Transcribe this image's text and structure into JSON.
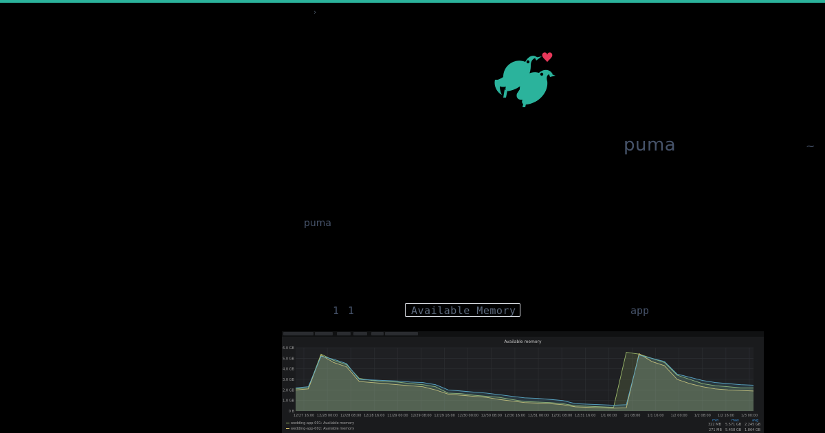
{
  "header": {
    "breadcrumb_glyph": "›"
  },
  "logo": {
    "name": "two-birds-heart-logo"
  },
  "hero": {
    "title": "puma",
    "tilde": "~"
  },
  "section": {
    "label": "puma"
  },
  "caption_row": {
    "number": "1 1",
    "highlighted": "Available Memory",
    "tag": "app"
  },
  "colors": {
    "accent": "#2bb39c",
    "heart": "#e8385a",
    "background": "#000000"
  },
  "chart_data": {
    "type": "area",
    "title": "Available memory",
    "ylabel": "",
    "xlabel": "",
    "ylim": [
      0,
      6
    ],
    "y_ticks": [
      "0 B",
      "1.0 GB",
      "2.0 GB",
      "3.0 GB",
      "4.0 GB",
      "5.0 GB",
      "6.0 GB"
    ],
    "x_ticks": [
      "12/27 16:00",
      "12/28 00:00",
      "12/28 08:00",
      "12/28 16:00",
      "12/29 00:00",
      "12/29 08:00",
      "12/29 16:00",
      "12/30 00:00",
      "12/30 08:00",
      "12/30 16:00",
      "12/31 00:00",
      "12/31 08:00",
      "12/31 16:00",
      "1/1 00:00",
      "1/1 08:00",
      "1/1 16:00",
      "1/2 00:00",
      "1/2 08:00",
      "1/2 16:00",
      "1/3 00:00"
    ],
    "grid": true,
    "legend_columns": [
      "min",
      "max",
      "avg"
    ],
    "series": [
      {
        "name": "wedding-app-001: Available memory",
        "color": "#9ab86a",
        "stats": [
          "322 MB",
          "5.571 GB",
          "2.245 GB"
        ],
        "values": [
          2.1,
          2.2,
          5.4,
          4.8,
          4.4,
          3.1,
          2.9,
          2.8,
          2.75,
          2.6,
          2.5,
          2.3,
          1.7,
          1.65,
          1.5,
          1.4,
          1.3,
          1.1,
          0.9,
          0.85,
          0.8,
          0.7,
          0.5,
          0.45,
          0.4,
          0.35,
          5.57,
          5.4,
          5.0,
          4.6,
          3.4,
          3.0,
          2.6,
          2.4,
          2.3,
          2.2,
          2.2
        ]
      },
      {
        "name": "wedding-app-002: Available memory",
        "color": "#d6c16a",
        "stats": [
          "271 MB",
          "5.458 GB",
          "1.864 GB"
        ],
        "values": [
          2.0,
          2.1,
          5.3,
          4.6,
          4.2,
          2.8,
          2.7,
          2.6,
          2.5,
          2.4,
          2.3,
          2.0,
          1.6,
          1.5,
          1.4,
          1.3,
          1.1,
          0.95,
          0.8,
          0.75,
          0.7,
          0.6,
          0.4,
          0.35,
          0.3,
          0.27,
          0.3,
          5.45,
          4.7,
          4.3,
          3.0,
          2.6,
          2.3,
          2.1,
          2.0,
          1.95,
          1.9
        ]
      },
      {
        "name": "",
        "color": "#5aa7c6",
        "values": [
          2.2,
          2.3,
          5.2,
          4.9,
          4.5,
          3.0,
          2.95,
          2.9,
          2.85,
          2.75,
          2.7,
          2.5,
          2.0,
          1.9,
          1.8,
          1.7,
          1.55,
          1.4,
          1.25,
          1.2,
          1.1,
          1.0,
          0.7,
          0.65,
          0.6,
          0.55,
          0.6,
          5.3,
          5.0,
          4.7,
          3.5,
          3.2,
          2.9,
          2.7,
          2.6,
          2.5,
          2.45
        ]
      }
    ]
  }
}
